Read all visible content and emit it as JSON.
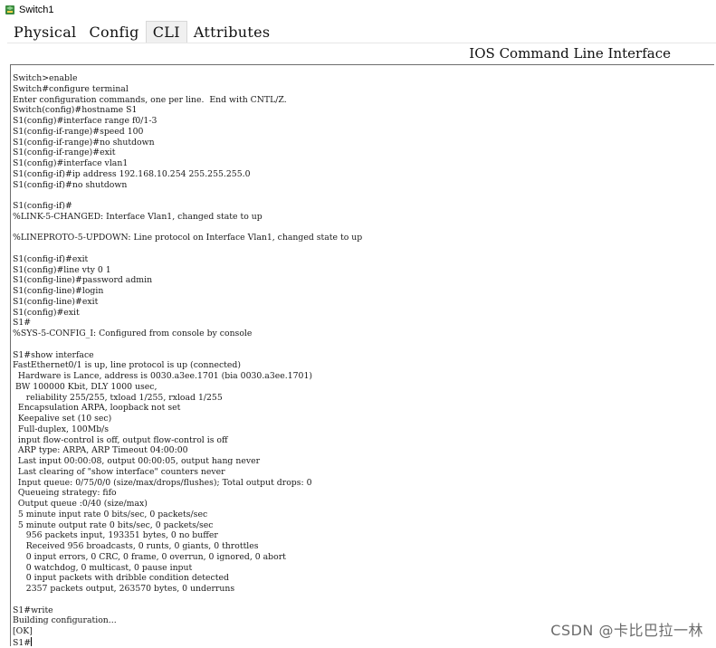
{
  "window": {
    "title": "Switch1"
  },
  "tabs": [
    {
      "label": "Physical"
    },
    {
      "label": "Config"
    },
    {
      "label": "CLI"
    },
    {
      "label": "Attributes"
    }
  ],
  "active_tab": "CLI",
  "cli": {
    "header": "IOS Command Line Interface",
    "lines": [
      "Switch>enable",
      "Switch#configure terminal",
      "Enter configuration commands, one per line.  End with CNTL/Z.",
      "Switch(config)#hostname S1",
      "S1(config)#interface range f0/1-3",
      "S1(config-if-range)#speed 100",
      "S1(config-if-range)#no shutdown",
      "S1(config-if-range)#exit",
      "S1(config)#interface vlan1",
      "S1(config-if)#ip address 192.168.10.254 255.255.255.0",
      "S1(config-if)#no shutdown",
      "",
      "S1(config-if)#",
      "%LINK-5-CHANGED: Interface Vlan1, changed state to up",
      "",
      "%LINEPROTO-5-UPDOWN: Line protocol on Interface Vlan1, changed state to up",
      "",
      "S1(config-if)#exit",
      "S1(config)#line vty 0 1",
      "S1(config-line)#password admin",
      "S1(config-line)#login",
      "S1(config-line)#exit",
      "S1(config)#exit",
      "S1#",
      "%SYS-5-CONFIG_I: Configured from console by console",
      "",
      "S1#show interface",
      "FastEthernet0/1 is up, line protocol is up (connected)",
      "  Hardware is Lance, address is 0030.a3ee.1701 (bia 0030.a3ee.1701)",
      " BW 100000 Kbit, DLY 1000 usec,",
      "     reliability 255/255, txload 1/255, rxload 1/255",
      "  Encapsulation ARPA, loopback not set",
      "  Keepalive set (10 sec)",
      "  Full-duplex, 100Mb/s",
      "  input flow-control is off, output flow-control is off",
      "  ARP type: ARPA, ARP Timeout 04:00:00",
      "  Last input 00:00:08, output 00:00:05, output hang never",
      "  Last clearing of \"show interface\" counters never",
      "  Input queue: 0/75/0/0 (size/max/drops/flushes); Total output drops: 0",
      "  Queueing strategy: fifo",
      "  Output queue :0/40 (size/max)",
      "  5 minute input rate 0 bits/sec, 0 packets/sec",
      "  5 minute output rate 0 bits/sec, 0 packets/sec",
      "     956 packets input, 193351 bytes, 0 no buffer",
      "     Received 956 broadcasts, 0 runts, 0 giants, 0 throttles",
      "     0 input errors, 0 CRC, 0 frame, 0 overrun, 0 ignored, 0 abort",
      "     0 watchdog, 0 multicast, 0 pause input",
      "     0 input packets with dribble condition detected",
      "     2357 packets output, 263570 bytes, 0 underruns",
      "",
      "S1#write",
      "Building configuration...",
      "[OK]",
      "S1#"
    ]
  },
  "watermark": "CSDN @卡比巴拉一林",
  "icons": {
    "app": "switch-app-icon"
  },
  "colors": {
    "tab_active_bg": "#f0f0f0",
    "console_border": "#6d6d6d"
  }
}
